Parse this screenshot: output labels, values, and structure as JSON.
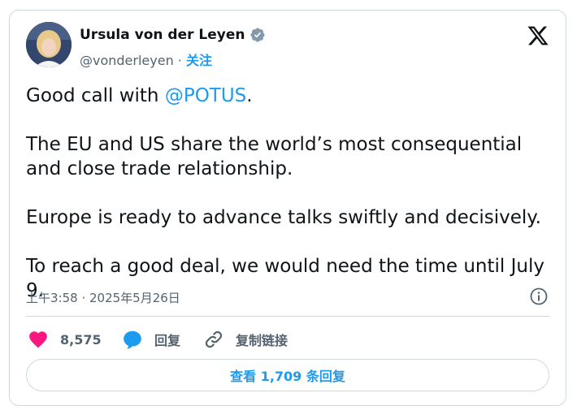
{
  "author": {
    "name": "Ursula von der Leyen",
    "handle": "@vonderleyen",
    "separator": " · ",
    "follow_label": "关注"
  },
  "tweet": {
    "line1_prefix": "Good call with ",
    "line1_mention": "@POTUS",
    "line1_suffix": ".",
    "paragraph2": "The EU and US share the world’s most consequential and close trade relationship.",
    "paragraph3": "Europe is ready to advance talks swiftly and decisively.",
    "paragraph4": "To reach a good deal, we would need the time until July 9."
  },
  "timestamp": "上午3:58 · 2025年5月26日",
  "actions": {
    "likes_count": "8,575",
    "reply_label": "回复",
    "copy_link_label": "复制链接"
  },
  "replies_button_label": "查看 1,709 条回复",
  "colors": {
    "accent": "#1d9bf0",
    "like": "#f91880",
    "verified": "#829aab",
    "text": "#0f1419",
    "muted": "#536471"
  },
  "icons": [
    "verified-badge-icon",
    "x-logo-icon",
    "info-icon",
    "heart-icon",
    "reply-bubble-icon",
    "link-icon"
  ]
}
